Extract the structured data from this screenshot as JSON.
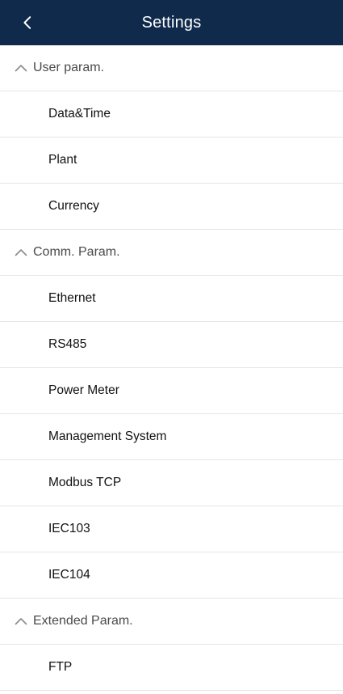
{
  "header": {
    "title": "Settings",
    "back_icon": "chevron-left-icon",
    "background_color": "#0f2a4b"
  },
  "sections": [
    {
      "label": "User param.",
      "icon": "chevron-up-icon",
      "items": [
        "Data&Time",
        "Plant",
        "Currency"
      ]
    },
    {
      "label": "Comm. Param.",
      "icon": "chevron-up-icon",
      "items": [
        "Ethernet",
        "RS485",
        "Power Meter",
        "Management System",
        "Modbus TCP",
        "IEC103",
        "IEC104"
      ]
    },
    {
      "label": "Extended Param.",
      "icon": "chevron-up-icon",
      "items": [
        "FTP"
      ]
    }
  ]
}
